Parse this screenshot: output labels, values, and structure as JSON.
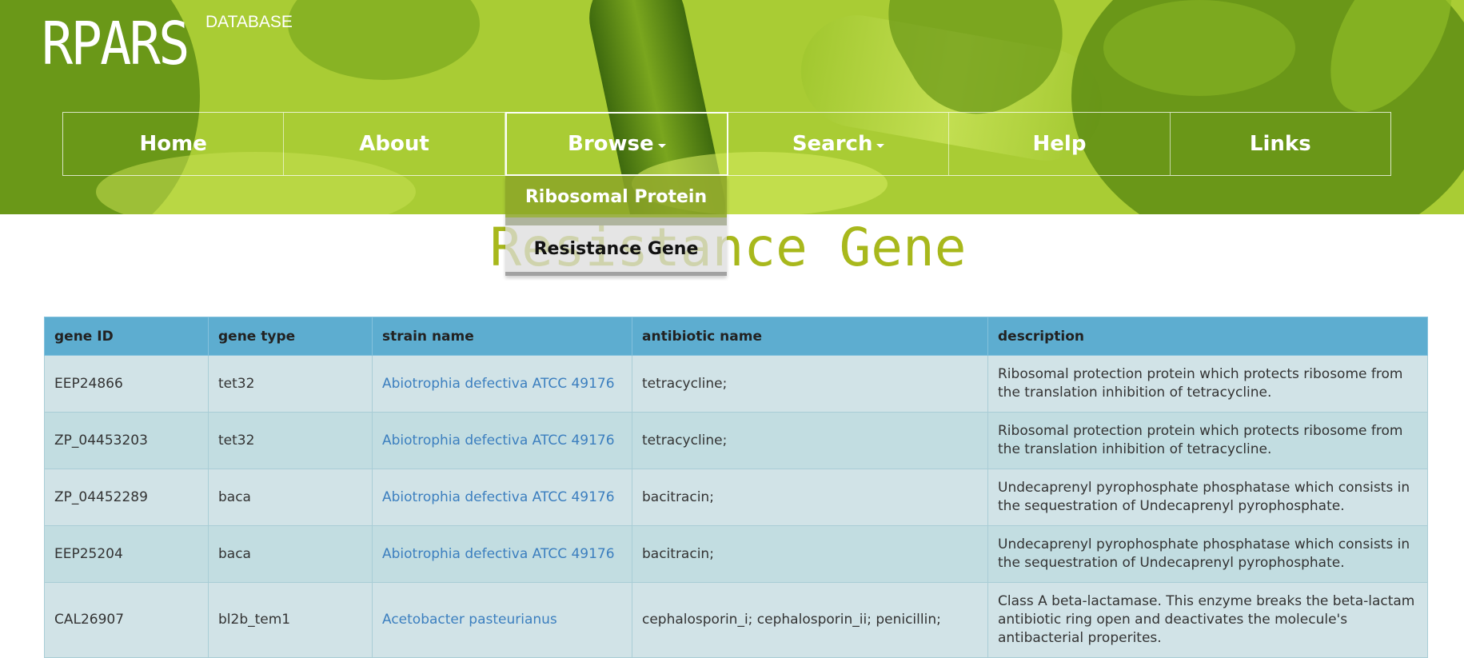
{
  "brand": {
    "name": "RPARS",
    "subtitle": "DATABASE"
  },
  "nav": {
    "items": [
      {
        "label": "Home",
        "has_dropdown": false
      },
      {
        "label": "About",
        "has_dropdown": false
      },
      {
        "label": "Browse",
        "has_dropdown": true
      },
      {
        "label": "Search",
        "has_dropdown": true
      },
      {
        "label": "Help",
        "has_dropdown": false
      },
      {
        "label": "Links",
        "has_dropdown": false
      }
    ],
    "active": "Browse"
  },
  "browse_menu": {
    "items": [
      "Ribosomal Protein",
      "Resistance Gene"
    ]
  },
  "page": {
    "title": "Resistance Gene"
  },
  "table": {
    "columns": [
      "gene ID",
      "gene type",
      "strain name",
      "antibiotic name",
      "description"
    ],
    "rows": [
      [
        "EEP24866",
        "tet32",
        "Abiotrophia defectiva ATCC 49176",
        "tetracycline;",
        "Ribosomal protection protein which protects ribosome from the translation inhibition of tetracycline."
      ],
      [
        "ZP_04453203",
        "tet32",
        "Abiotrophia defectiva ATCC 49176",
        "tetracycline;",
        "Ribosomal protection protein which protects ribosome from the translation inhibition of tetracycline."
      ],
      [
        "ZP_04452289",
        "baca",
        "Abiotrophia defectiva ATCC 49176",
        "bacitracin;",
        "Undecaprenyl pyrophosphate phosphatase which consists in the sequestration of Undecaprenyl pyrophosphate."
      ],
      [
        "EEP25204",
        "baca",
        "Abiotrophia defectiva ATCC 49176",
        "bacitracin;",
        "Undecaprenyl pyrophosphate phosphatase which consists in the sequestration of Undecaprenyl pyrophosphate."
      ],
      [
        "CAL26907",
        "bl2b_tem1",
        "Acetobacter pasteurianus",
        "cephalosporin_i; cephalosporin_ii; penicillin;",
        "Class A beta-lactamase. This enzyme breaks the beta-lactam antibiotic ring open and deactivates the molecule's antibacterial properites."
      ]
    ]
  },
  "colors": {
    "banner_green": "#b4d83c",
    "title_olive": "#a8b81c",
    "table_header": "#5dadd0",
    "link": "#3c7fbf"
  }
}
